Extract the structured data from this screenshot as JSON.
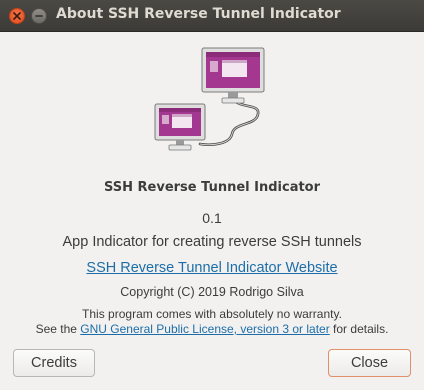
{
  "window": {
    "title": "About SSH Reverse Tunnel Indicator"
  },
  "titlebar_buttons": {
    "close_icon": "close-icon",
    "minimize_icon": "minimize-icon"
  },
  "logo": {
    "icon": "connected-monitors-icon",
    "accent_color": "#a4378f"
  },
  "about": {
    "app_name": "SSH Reverse Tunnel Indicator",
    "version": "0.1",
    "comments": "App Indicator for creating reverse SSH tunnels",
    "website_label": "SSH Reverse Tunnel Indicator Website",
    "copyright": "Copyright (C) 2019 Rodrigo Silva",
    "license_line1": "This program comes with absolutely no warranty.",
    "license_prefix": "See the ",
    "license_link": "GNU General Public License, version 3 or later",
    "license_suffix": " for details."
  },
  "buttons": {
    "credits": "Credits",
    "close": "Close"
  },
  "colors": {
    "link": "#1d6ea8",
    "titlebar": "#3c3b37",
    "close_button": "#e0481c"
  }
}
